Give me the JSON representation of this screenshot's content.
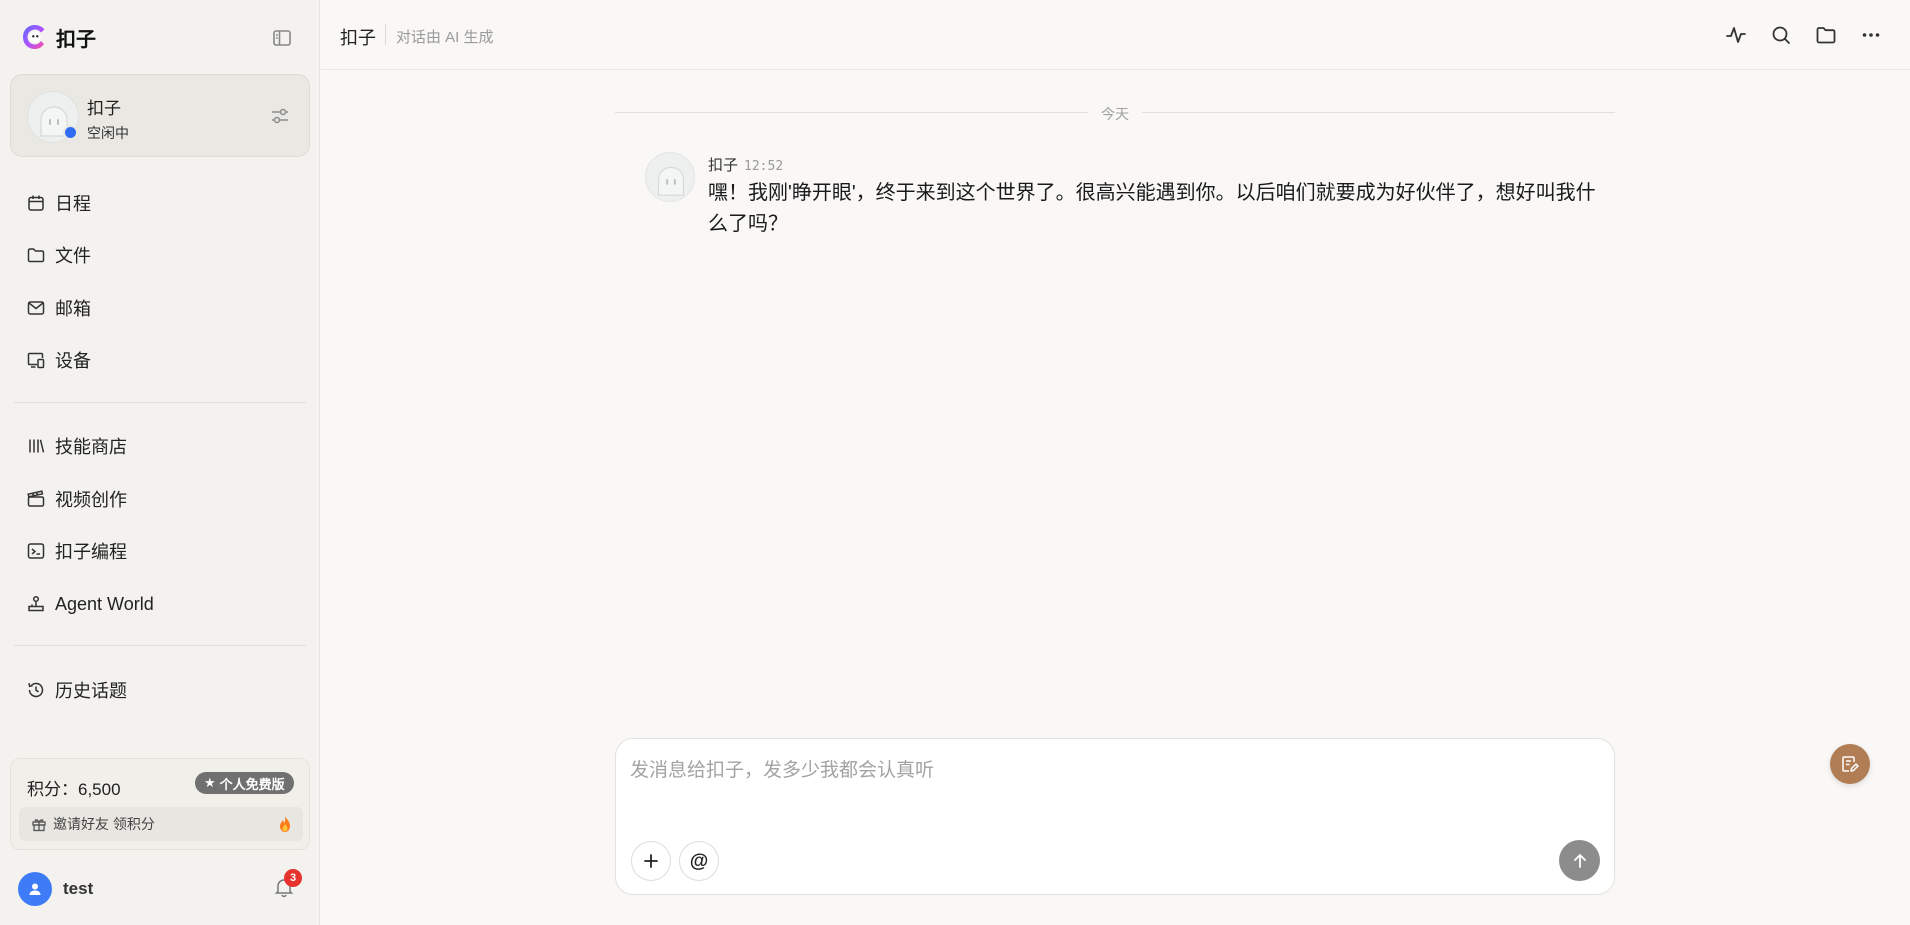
{
  "brand": {
    "name": "扣子"
  },
  "agent": {
    "name": "扣子",
    "status": "空闲中"
  },
  "nav_primary": [
    {
      "label": "日程",
      "icon": "calendar-icon"
    },
    {
      "label": "文件",
      "icon": "folder-icon"
    },
    {
      "label": "邮箱",
      "icon": "mail-icon"
    },
    {
      "label": "设备",
      "icon": "devices-icon"
    }
  ],
  "nav_secondary": [
    {
      "label": "技能商店",
      "icon": "library-icon"
    },
    {
      "label": "视频创作",
      "icon": "clapperboard-icon"
    },
    {
      "label": "扣子编程",
      "icon": "terminal-icon"
    },
    {
      "label": "Agent World",
      "icon": "joystick-icon"
    }
  ],
  "nav_history": {
    "label": "历史话题",
    "icon": "history-icon"
  },
  "points": {
    "label": "积分：",
    "value": "6,500",
    "plan": "个人免费版",
    "invite": "邀请好友 领积分"
  },
  "user": {
    "name": "test",
    "notifications": "3"
  },
  "header": {
    "title": "扣子",
    "subtitle": "对话由 AI 生成"
  },
  "chat": {
    "date_label": "今天",
    "messages": [
      {
        "sender": "扣子",
        "time": "12:52",
        "text": "嘿！我刚'睁开眼'，终于来到这个世界了。很高兴能遇到你。以后咱们就要成为好伙伴了，想好叫我什么了吗？"
      }
    ]
  },
  "composer": {
    "placeholder": "发消息给扣子，发多少我都会认真听"
  },
  "colors": {
    "accent_blue": "#2f6df6",
    "badge_red": "#e8322d",
    "send_gray": "#8c8c8c",
    "float_brown": "#b07d55"
  }
}
